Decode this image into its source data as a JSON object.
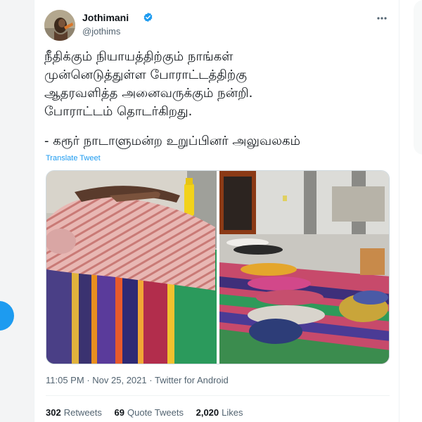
{
  "tweet": {
    "display_name": "Jothimani",
    "handle": "@jothims",
    "verified_icon": "verified-badge-icon",
    "more_icon": "more-options-icon",
    "text_lines": [
      "நீதிக்கும் நியாயத்திற்கும் நாங்கள்",
      "முன்னெடுத்துள்ள போராட்டத்திற்கு",
      "ஆதரவளித்த அனைவருக்கும் நன்றி.",
      "போராட்டம் தொடர்கிறது."
    ],
    "signature": "- கரூர் நாடாளுமன்ற உறுப்பினர் அலுவலகம்",
    "translate_label": "Translate Tweet",
    "time": "11:05 PM",
    "date": "Nov 25, 2021",
    "source": "Twitter for Android",
    "separator": "·"
  },
  "stats": {
    "retweets_count": "302",
    "retweets_label": "Retweets",
    "quotes_count": "69",
    "quotes_label": "Quote Tweets",
    "likes_count": "2,020",
    "likes_label": "Likes"
  },
  "colors": {
    "accent": "#1d9bf0",
    "text_primary": "#0f1419",
    "text_secondary": "#536471"
  }
}
